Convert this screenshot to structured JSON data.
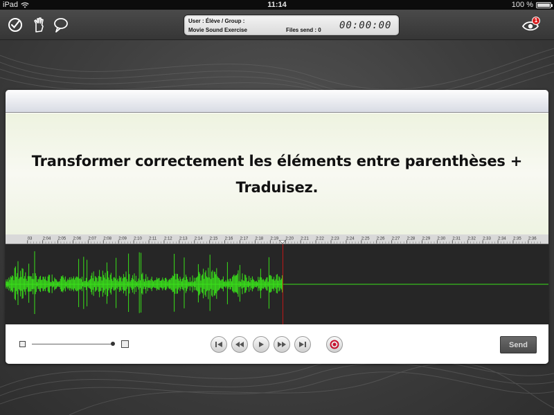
{
  "status_bar": {
    "device": "iPad",
    "time": "11:14",
    "battery": "100 %"
  },
  "toolbar": {
    "icons": [
      "checkmark-pen-icon",
      "hand-icon",
      "speech-bubble-icon",
      "eye-notification-icon"
    ],
    "notification_count": "1",
    "info": {
      "user_line": "User : Élève / Group :",
      "group_value": "Movie Sound Exercise",
      "files_sent": "Files send : 0",
      "timer": "00:00:00"
    }
  },
  "video": {
    "caption": "Transformer correctement les éléments entre parenthèses + Traduisez."
  },
  "timeline": {
    "ticks": [
      "03",
      "2:04",
      "2:05",
      "2:06",
      "2:07",
      "2:08",
      "2:09",
      "2:10",
      "2:11",
      "2:12",
      "2:13",
      "2:14",
      "2:15",
      "2:16",
      "2:17",
      "2:18",
      "2:19",
      "2:20",
      "2:21",
      "2:22",
      "2:23",
      "2:24",
      "2:25",
      "2:26",
      "2:27",
      "2:28",
      "2:29",
      "2:30",
      "2:31",
      "2:32",
      "2:33",
      "2:34",
      "2:35",
      "2:36"
    ],
    "playhead_time": "2:19.8",
    "waveform_color": "#39e21a",
    "playhead_color": "#c01818"
  },
  "controls": {
    "buttons": [
      "skip-to-start",
      "rewind",
      "play",
      "fast-forward",
      "skip-to-end",
      "record"
    ],
    "volume_level": 0.97,
    "send_label": "Send"
  },
  "colors": {
    "waveform": "#39e21a",
    "record": "#c8102e"
  }
}
